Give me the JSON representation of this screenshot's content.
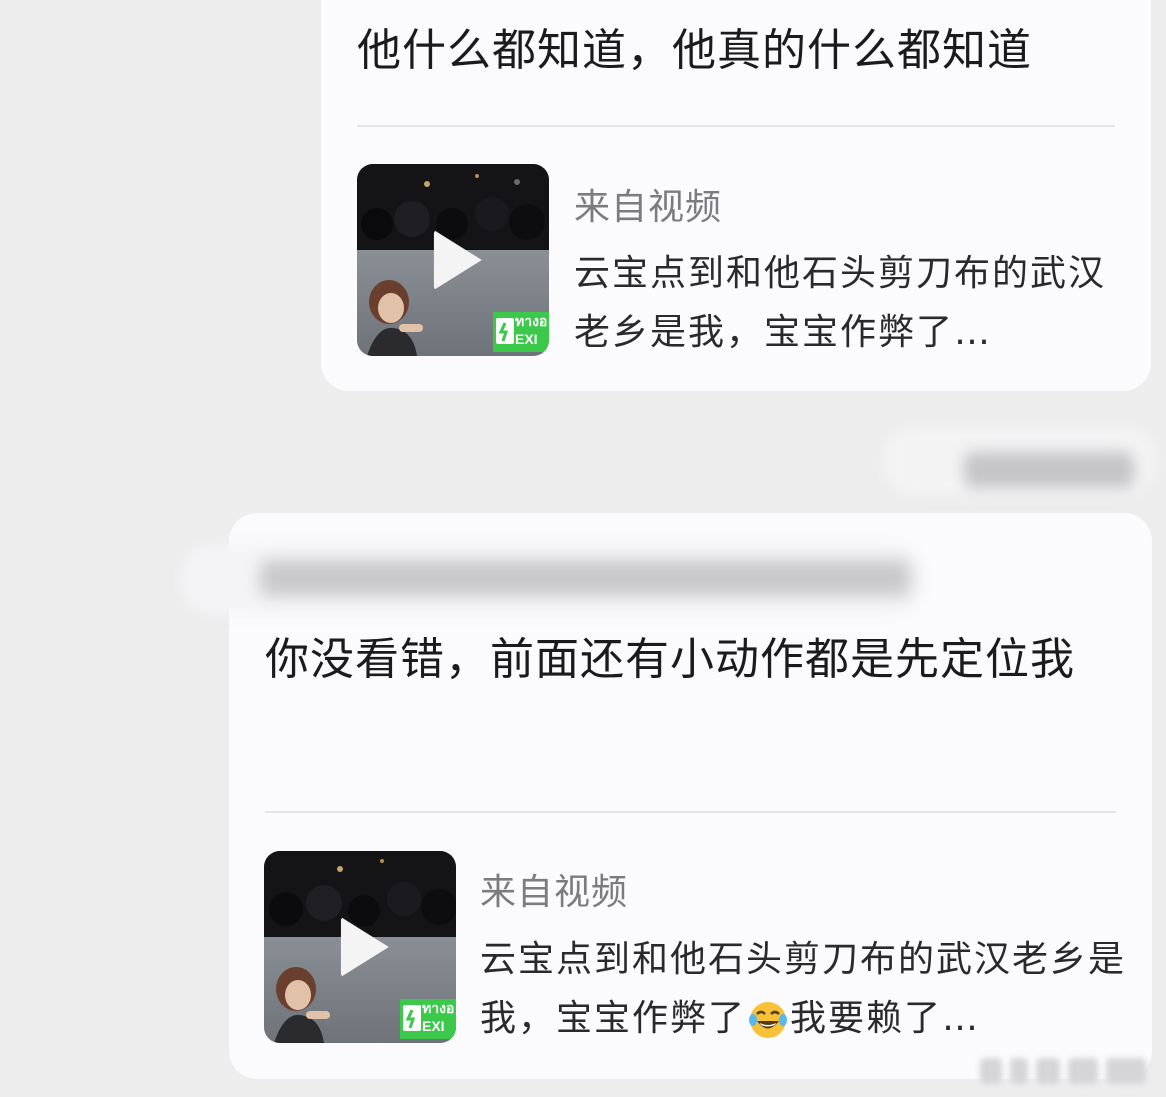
{
  "messages": [
    {
      "text": "他什么都知道，他真的什么都知道",
      "source_label": "来自视频",
      "video_caption": "云宝点到和他石头剪刀布的武汉老乡是我，宝宝作弊了…"
    },
    {
      "text": "你没看错，前面还有小动作都是先定位我",
      "source_label": "来自视频",
      "video_caption_before_emoji": "云宝点到和他石头剪刀布的武汉老乡是我，宝宝作弊了",
      "video_caption_emoji": "face-with-tears-of-joy",
      "video_caption_after_emoji": "我要赖了…"
    }
  ],
  "thumbnail": {
    "icon": "play-icon",
    "sign_text_line1": "ทางอ",
    "sign_text_line2": "EXI"
  },
  "colors": {
    "background": "#ededee",
    "card": "#fbfbfd",
    "primary_text": "#1b1b1d",
    "secondary_text": "#7c7c80",
    "exit_sign": "#3cc94b"
  }
}
